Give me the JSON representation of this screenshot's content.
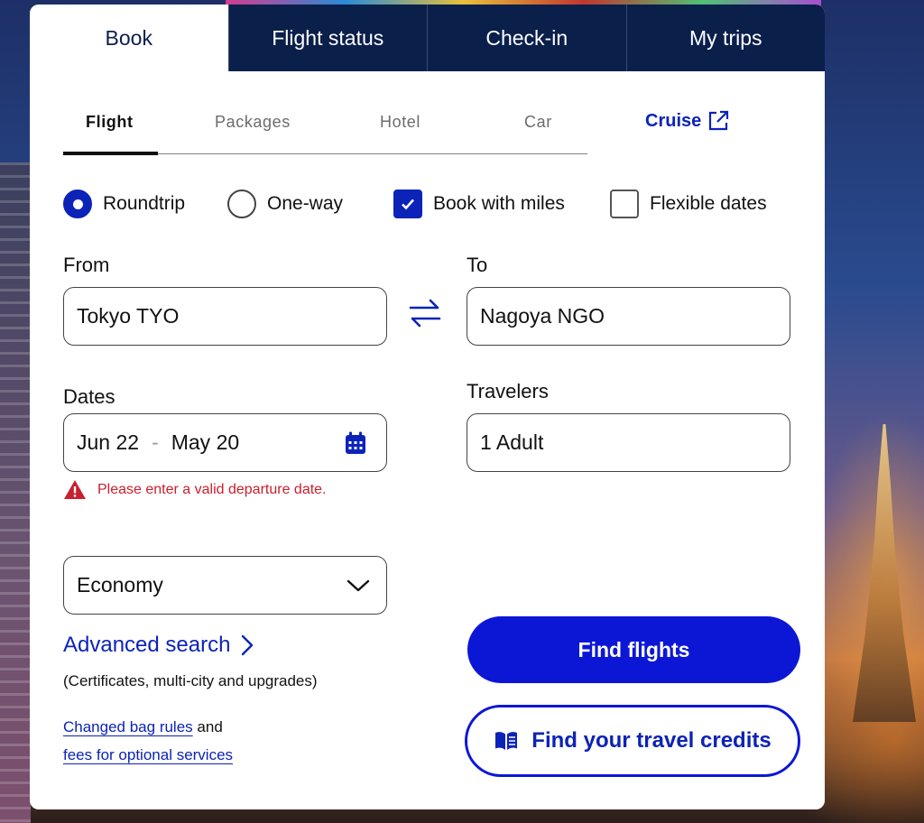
{
  "top_tabs": [
    {
      "label": "Book"
    },
    {
      "label": "Flight status"
    },
    {
      "label": "Check-in"
    },
    {
      "label": "My trips"
    }
  ],
  "sub_tabs": [
    {
      "label": "Flight"
    },
    {
      "label": "Packages"
    },
    {
      "label": "Hotel"
    },
    {
      "label": "Car"
    }
  ],
  "cruise": {
    "label": "Cruise",
    "icon": "external-link-icon"
  },
  "trip_options": {
    "roundtrip": "Roundtrip",
    "one_way": "One-way",
    "book_with_miles": "Book with miles",
    "flexible_dates": "Flexible dates"
  },
  "from": {
    "label": "From",
    "value": "Tokyo TYO"
  },
  "to": {
    "label": "To",
    "value": "Nagoya NGO"
  },
  "dates": {
    "label": "Dates",
    "depart": "Jun 22",
    "separator": "-",
    "return": "May 20"
  },
  "travelers": {
    "label": "Travelers",
    "value": "1 Adult"
  },
  "error": {
    "message": "Please enter a valid departure date."
  },
  "cabin": {
    "value": "Economy"
  },
  "advanced_search": {
    "label": "Advanced search",
    "sub": "(Certificates, multi-city and upgrades)"
  },
  "links": {
    "bag_rules": "Changed bag rules",
    "and": "and",
    "fees": "fees for optional services"
  },
  "buttons": {
    "find_flights": "Find flights",
    "travel_credits": "Find your travel credits"
  },
  "colors": {
    "brand_blue": "#0c23b8",
    "navy": "#0b1f4b",
    "error_red": "#c8202e"
  }
}
